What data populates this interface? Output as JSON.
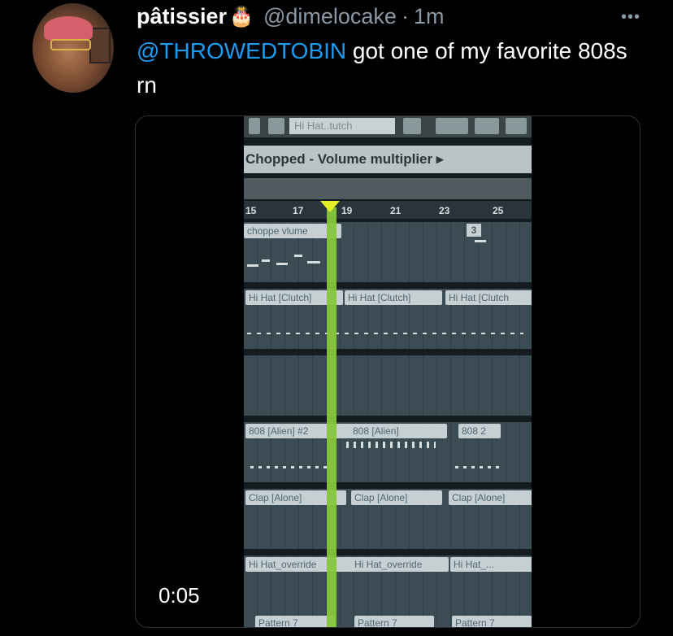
{
  "author": {
    "display_name": "pâtissier",
    "name_emoji": "🎂",
    "handle": "@dimelocake",
    "separator": "·",
    "time": "1m"
  },
  "more_icon": "•••",
  "tweet": {
    "mention": "@THROWEDTOBIN",
    "text_rest": " got one of my favorite 808s rn"
  },
  "video": {
    "timestamp": "0:05",
    "screen": {
      "toolbar_field": "Hi Hat..tutch",
      "breadcrumb": "Chopped - Volume multiplier ▸",
      "ruler_marks": [
        "15",
        "17",
        "19",
        "21",
        "23",
        "25"
      ],
      "marker_25": "3",
      "clips": [
        {
          "label": "choppe vlume"
        },
        {
          "label": "Hi Hat [Clutch]"
        },
        {
          "label": "Hi Hat [Clutch]"
        },
        {
          "label": "Hi Hat [Clutch"
        },
        {
          "label": "808 [Alien] #2"
        },
        {
          "label": "808 [Alien]"
        },
        {
          "label": "808 2"
        },
        {
          "label": "Clap [Alone]"
        },
        {
          "label": "Clap [Alone]"
        },
        {
          "label": "Clap [Alone]"
        },
        {
          "label": "Hi Hat_override"
        },
        {
          "label": "Hi Hat_override"
        },
        {
          "label": "Hi Hat_..."
        },
        {
          "label": "Pattern 7"
        },
        {
          "label": "Pattern 7"
        },
        {
          "label": "Pattern 7"
        }
      ]
    }
  },
  "colors": {
    "background": "#000000",
    "link": "#1d9bf0",
    "secondary_text": "#8b98a5",
    "playhead": "#86c63c"
  }
}
